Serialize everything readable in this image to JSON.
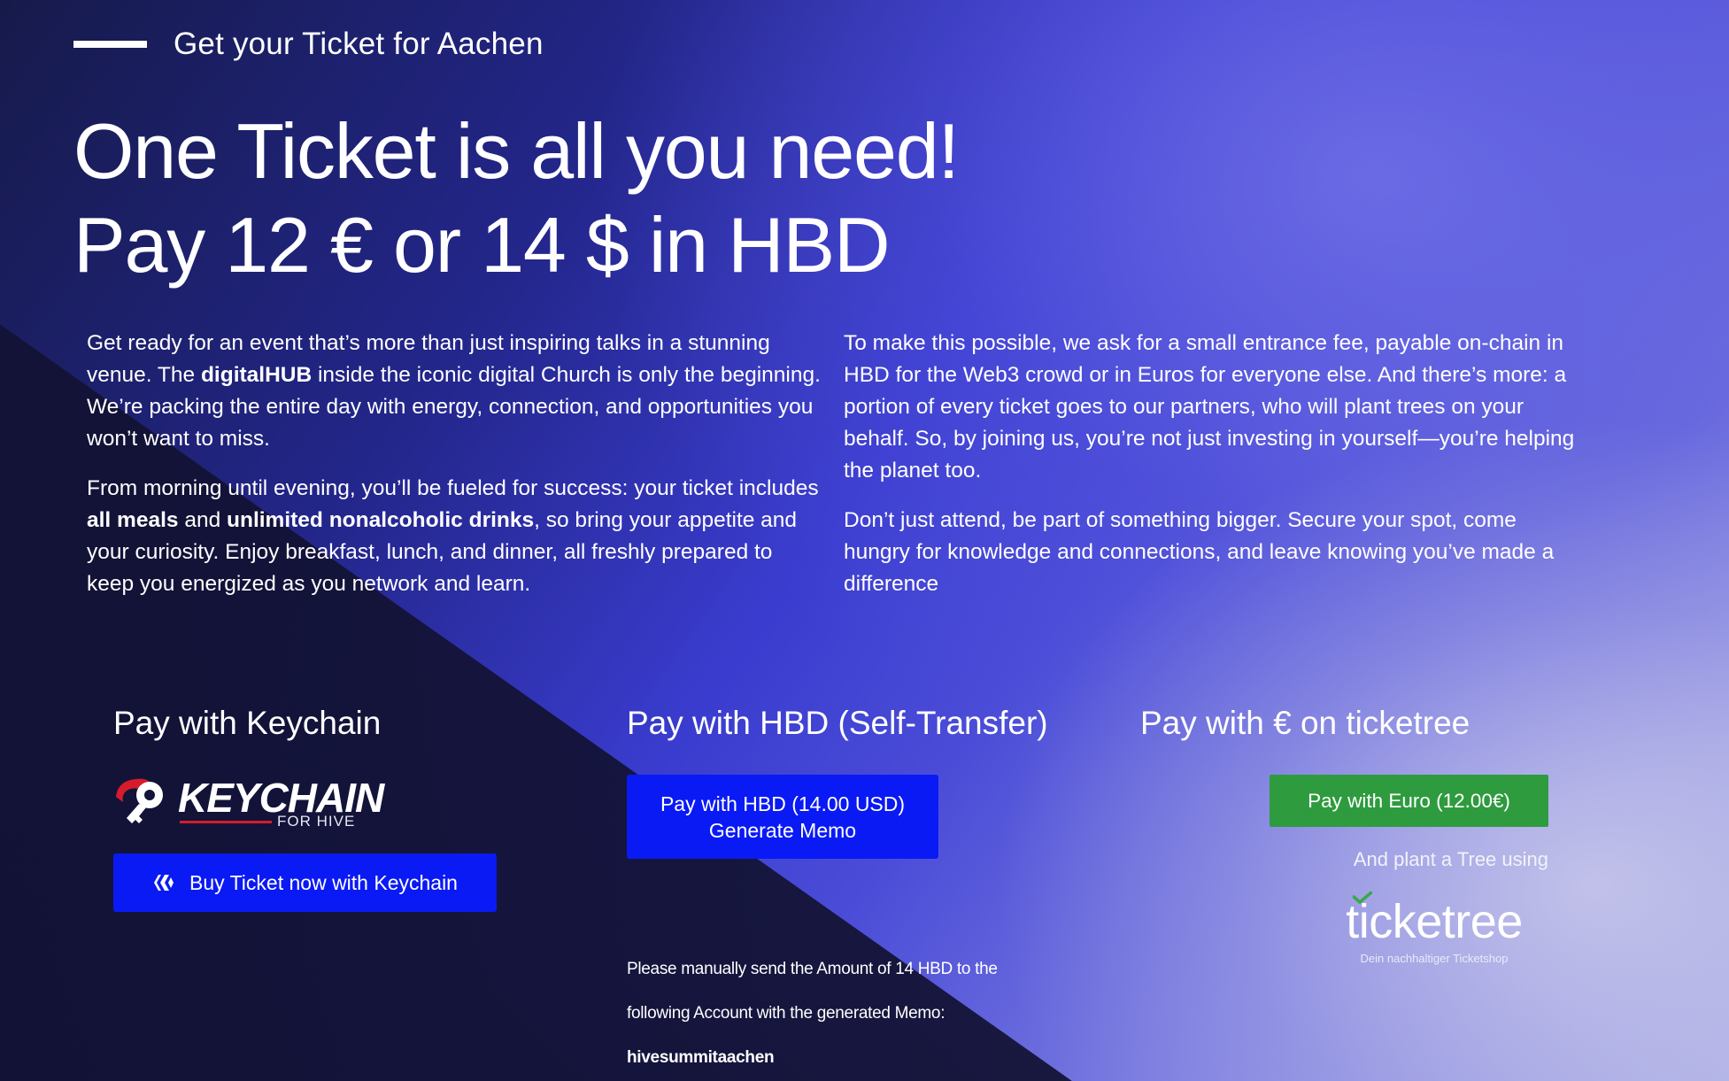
{
  "header": {
    "eyebrow": "Get your Ticket for Aachen",
    "headline_line1": "One Ticket is all you need!",
    "headline_line2": "Pay 12 € or 14 $ in HBD"
  },
  "intro_left": {
    "p1_before": "Get ready for an event that’s more than just inspiring talks in a stunning venue. The ",
    "p1_bold": "digitalHUB",
    "p1_after": " inside the iconic digital Church is only the beginning. We’re packing the entire day with energy, connection, and opportunities you won’t want to miss.",
    "p2_before": "From morning until evening, you’ll be fueled for success: your ticket includes ",
    "p2_bold1": "all meals",
    "p2_mid": " and ",
    "p2_bold2": "unlimited nonalcoholic drinks",
    "p2_after": ", so bring your appetite and your curiosity. Enjoy breakfast, lunch, and dinner, all freshly prepared to keep you energized as you network and learn."
  },
  "intro_right": {
    "p1": "To make this possible, we ask for a small entrance fee, payable on-chain in HBD for the Web3 crowd or in Euros for everyone else. And there’s more: a portion of every ticket goes to our partners, who will plant trees on your behalf. So, by joining us, you’re not just investing in yourself—you’re helping the planet too.",
    "p2": "Don’t just attend, be part of something bigger. Secure your spot, come hungry for knowledge and connections, and leave knowing you’ve made a difference"
  },
  "keychain": {
    "title": "Pay with Keychain",
    "logo_word": "KEYCHAIN",
    "logo_sub": "FOR HIVE",
    "button_label": "Buy Ticket now with Keychain",
    "icon": "hive-icon"
  },
  "hbd": {
    "title": "Pay with HBD (Self-Transfer)",
    "button_line1": "Pay with HBD (14.00 USD)",
    "button_line2": "Generate Memo",
    "instructions_line1": "Please manually send the Amount of 14 HBD to the",
    "instructions_line2": "following Account with the generated Memo:",
    "account": "hivesummitaachen"
  },
  "euro": {
    "title": "Pay with € on ticketree",
    "button_label": "Pay with Euro (12.00€)",
    "plant_text": "And plant a Tree using",
    "logo_word": "ticketree",
    "logo_tagline": "Dein nachhaltiger Ticketshop"
  },
  "colors": {
    "primary_button": "#0a1af5",
    "euro_button": "#2e9b3f",
    "keychain_red": "#d61c2a"
  }
}
